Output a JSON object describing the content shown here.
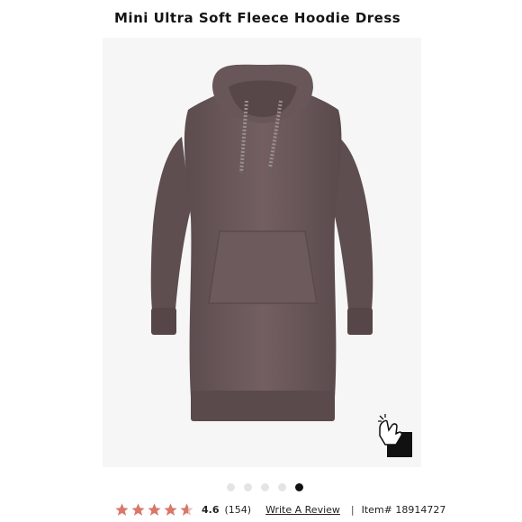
{
  "product": {
    "title": "Mini Ultra Soft Fleece Hoodie Dress",
    "item_number": "Item# 18914727"
  },
  "rating": {
    "value": "4.6",
    "stars_fraction": 0.92,
    "count": "(154)",
    "write_review_label": "Write A Review"
  },
  "carousel": {
    "total": 5,
    "active_index": 4
  },
  "colors": {
    "garment": "#6b5a5c",
    "star": "#d9776a",
    "active_dot": "#111111"
  },
  "icons": {
    "zoom": "zoom-hand-icon",
    "star": "star-icon"
  }
}
